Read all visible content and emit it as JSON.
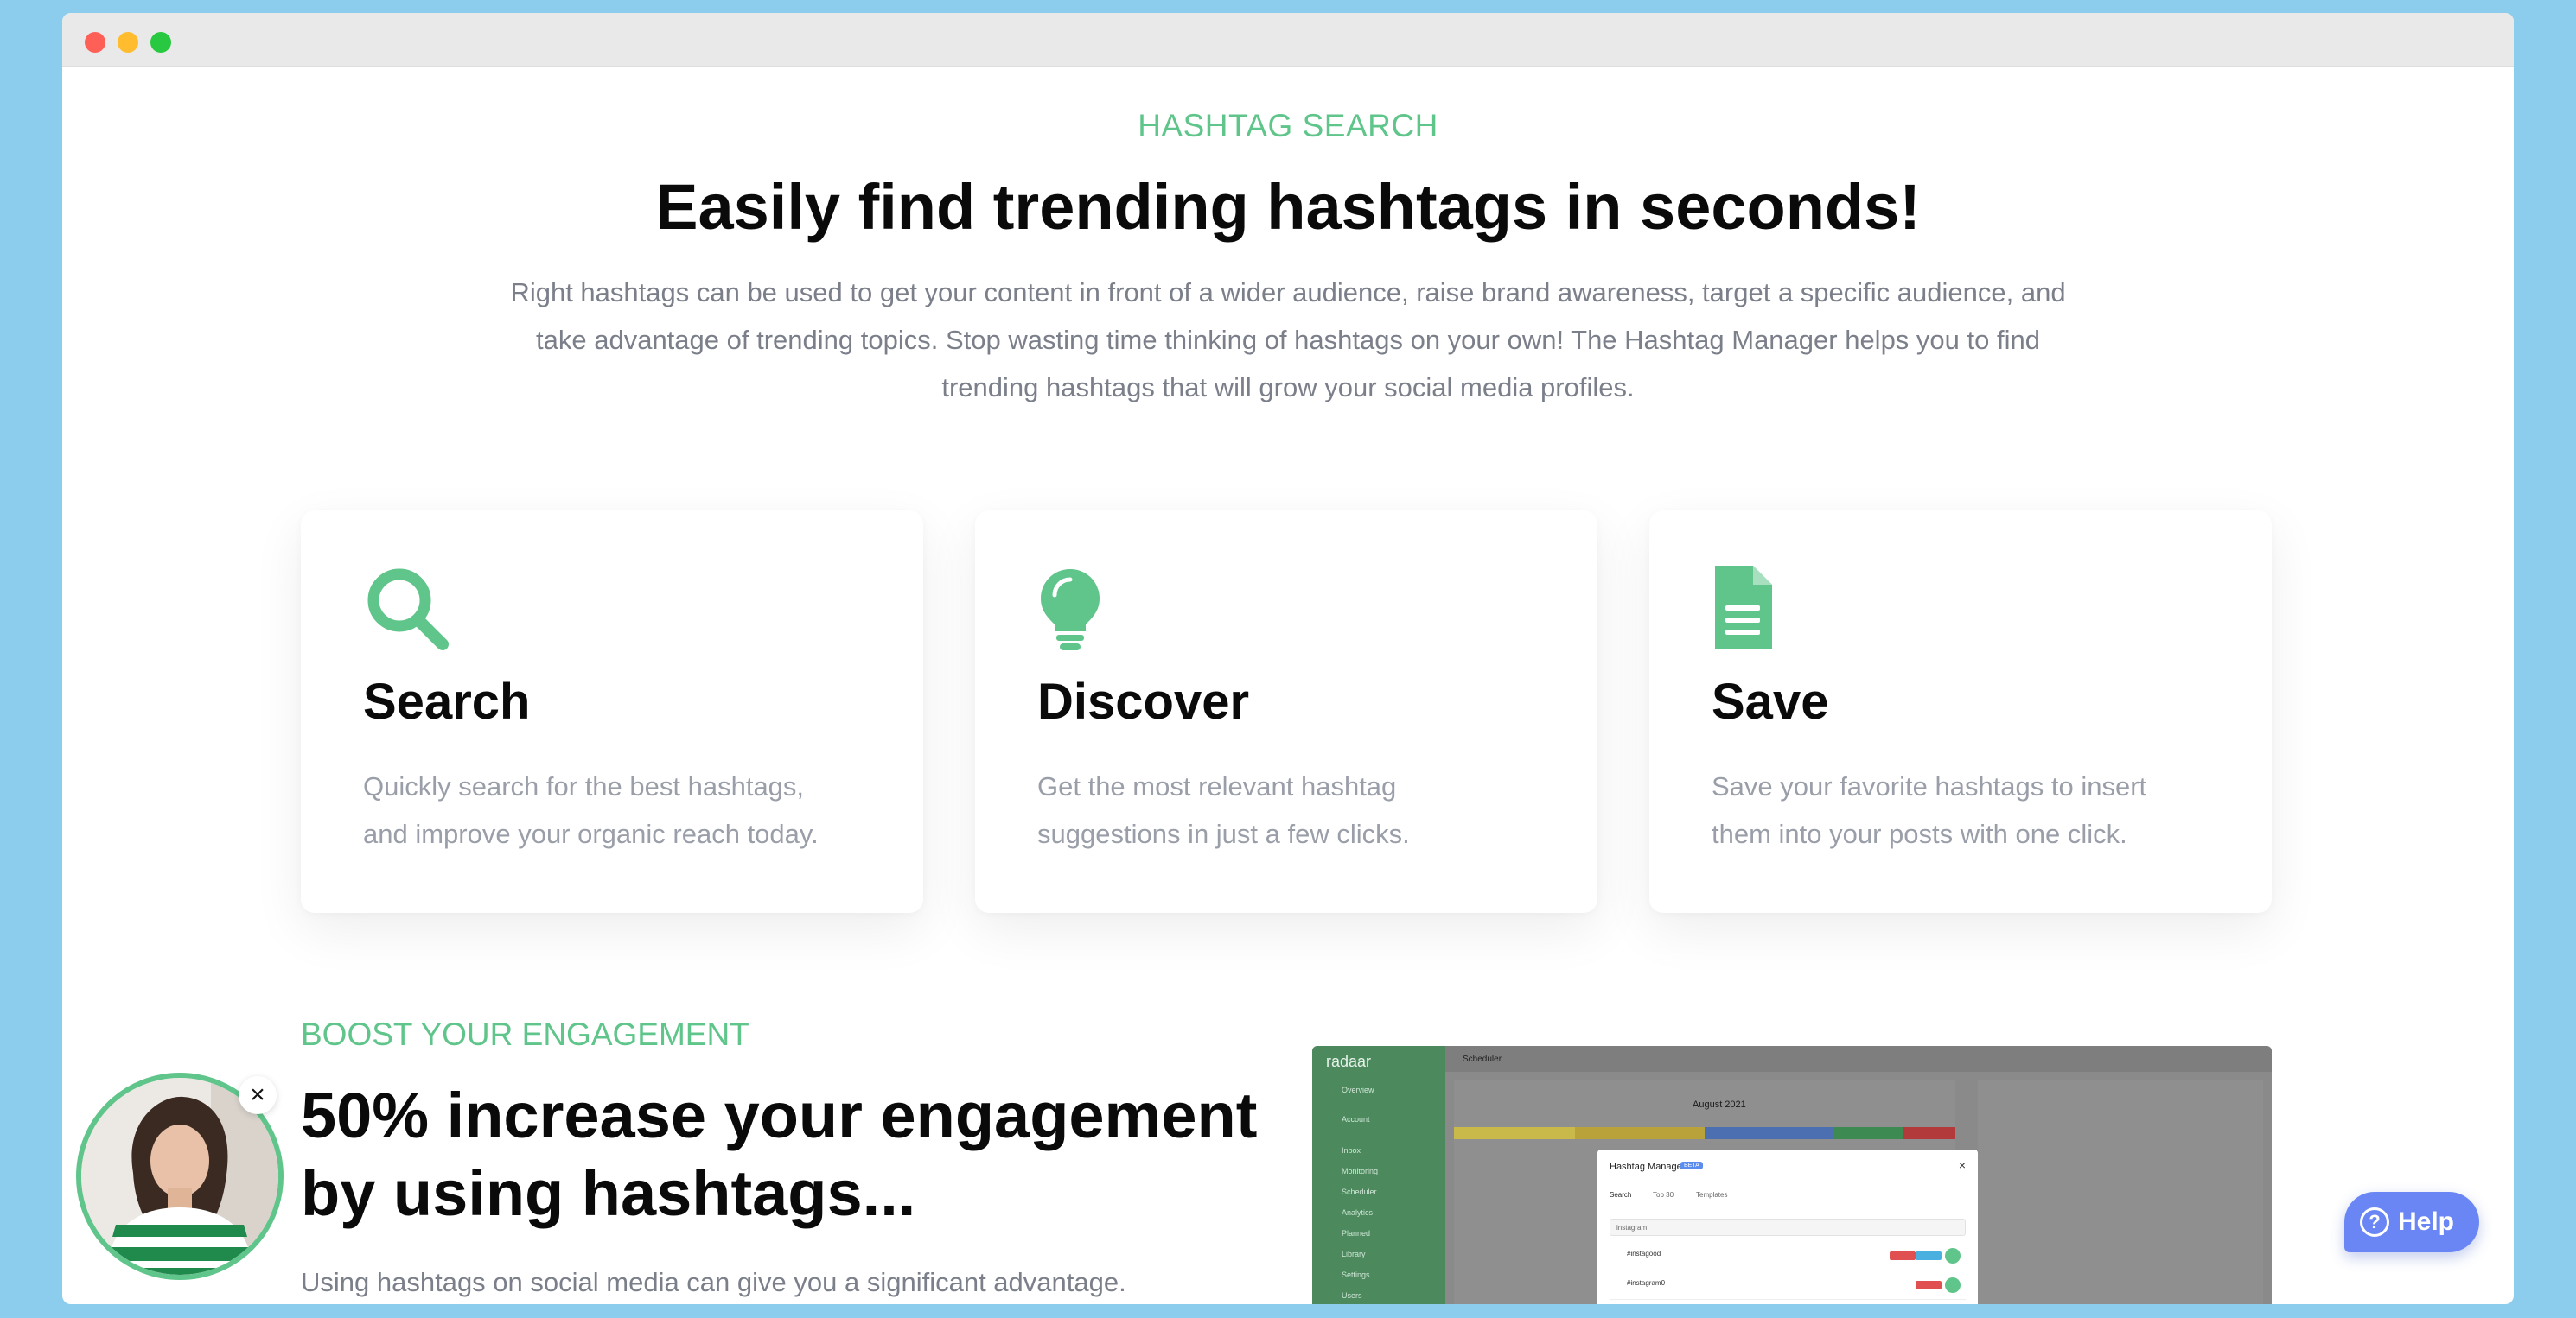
{
  "hero": {
    "eyebrow": "HASHTAG SEARCH",
    "title": "Easily find trending hashtags in seconds!",
    "description_lines": [
      "Right hashtags can be used to get your content in front of a wider audience, raise brand awareness, target a specific audience, and",
      "take advantage of trending topics. Stop wasting time thinking of hashtags on your own! The Hashtag Manager helps you to find",
      "trending hashtags that will grow your social media profiles."
    ]
  },
  "features": [
    {
      "icon": "search-icon",
      "title": "Search",
      "desc_lines": [
        "Quickly search for the best hashtags,",
        "and improve your organic reach today."
      ]
    },
    {
      "icon": "lightbulb-icon",
      "title": "Discover",
      "desc_lines": [
        "Get the most relevant hashtag",
        "suggestions in just a few clicks."
      ]
    },
    {
      "icon": "document-icon",
      "title": "Save",
      "desc_lines": [
        "Save your favorite hashtags to insert",
        "them into your posts with one click."
      ]
    }
  ],
  "boost": {
    "eyebrow": "BOOST YOUR ENGAGEMENT",
    "title_lines": [
      "50% increase your engagement",
      "by using hashtags..."
    ],
    "description": "Using hashtags on social media can give you a significant advantage."
  },
  "app_preview": {
    "logo": "radaar",
    "sidebar_items": [
      "Overview",
      "Account",
      "Inbox",
      "Monitoring",
      "Scheduler",
      "Analytics",
      "Planned",
      "Library",
      "Settings",
      "Users"
    ],
    "topbar_label": "Scheduler",
    "calendar_month": "August 2021",
    "modal_title": "Hashtag Manager",
    "modal_badge": "BETA",
    "modal_tabs": [
      "Search",
      "Top 30",
      "Templates"
    ],
    "modal_input": "instagram",
    "modal_rows": [
      "#instagood",
      "#instagram0"
    ]
  },
  "help": {
    "label": "Help",
    "q": "?"
  },
  "avatar": {
    "close": "×"
  },
  "colors": {
    "accent": "#5fc58a",
    "help": "#6a86f4",
    "background": "#8ccdee"
  }
}
